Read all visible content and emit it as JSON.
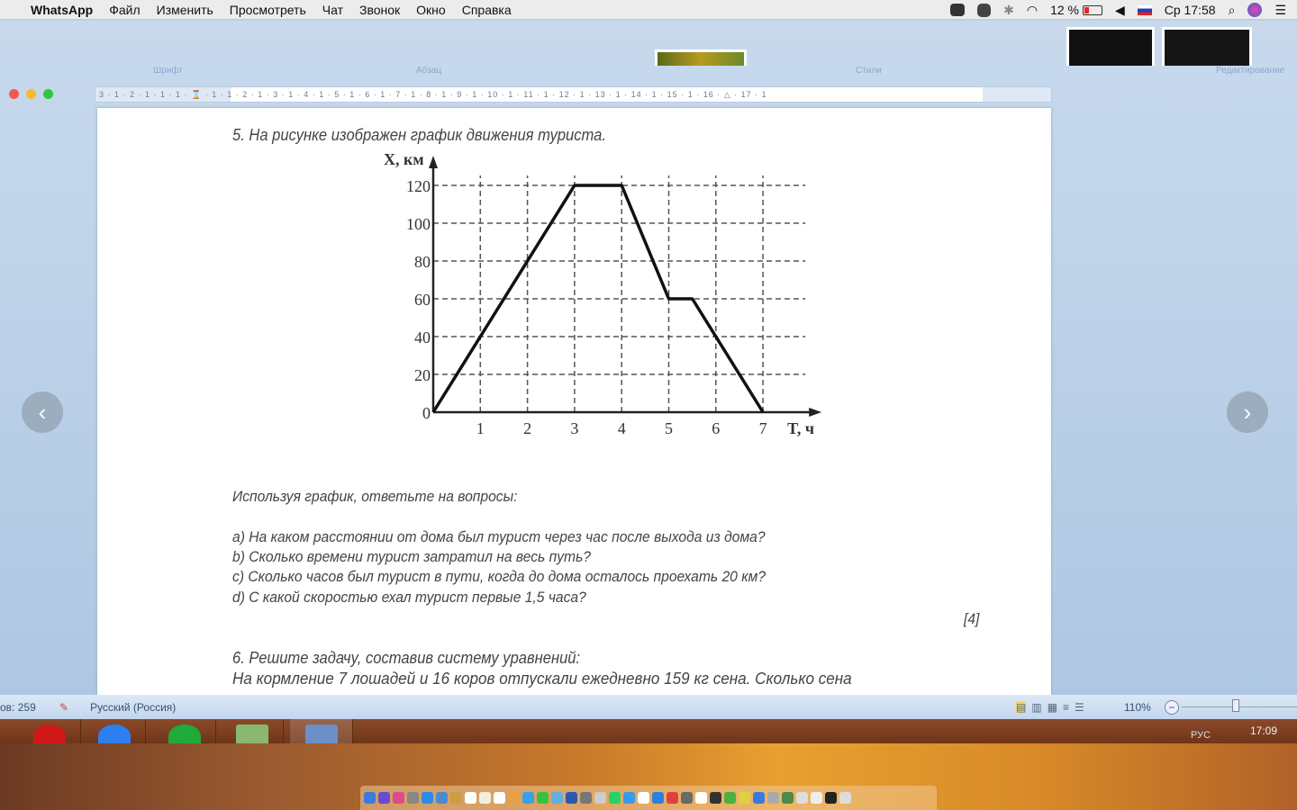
{
  "menubar": {
    "app": "WhatsApp",
    "items": [
      "Файл",
      "Изменить",
      "Просмотреть",
      "Чат",
      "Звонок",
      "Окно",
      "Справка"
    ],
    "battery": "12 %",
    "clock": "Ср 17:58"
  },
  "ribbon": {
    "groups": [
      "Шрифт",
      "Абзац",
      "Стили",
      "Редактирование"
    ]
  },
  "ruler": {
    "text": "3 · 1 · 2 · 1 · 1 · 1 · ⌛ · 1 · 1 · 2 · 1 · 3 · 1 · 4 · 1 · 5 · 1 · 6 · 1 · 7 · 1 · 8 · 1 · 9 · 1 · 10 · 1 · 11 · 1 · 12 · 1 · 13 · 1 · 14 · 1 · 15 · 1 · 16 · △ · 17 · 1"
  },
  "document": {
    "task5": "5. На рисунке изображен график движения туриста.",
    "instruction": "Используя график, ответьте на вопросы:",
    "questions": [
      "a) На каком расстоянии от дома был турист через час после выхода из дома?",
      "b) Сколько времени турист затратил на весь путь?",
      "c) Сколько часов был турист в пути, когда до дома осталось проехать 20 км?",
      "d) С какой скоростью ехал турист первые 1,5 часа?"
    ],
    "points": "[4]",
    "task6": "6. Решите задачу, составив систему уравнений:",
    "task6_text": "На кормление 7 лошадей и 16 коров отпускали ежедневно 159 кг сена. Сколько сена"
  },
  "chart_data": {
    "type": "line",
    "ylabel": "X, км",
    "xlabel": "T, ч",
    "x_ticks": [
      "1",
      "2",
      "3",
      "4",
      "5",
      "6",
      "7"
    ],
    "y_ticks": [
      "0",
      "20",
      "40",
      "60",
      "80",
      "100",
      "120"
    ],
    "grid": true,
    "xlim": [
      0,
      7.9
    ],
    "ylim": [
      0,
      130
    ],
    "series": [
      {
        "x": [
          0,
          3,
          4,
          5,
          5.5,
          7
        ],
        "y": [
          0,
          120,
          120,
          60,
          60,
          0
        ]
      }
    ]
  },
  "statusbar": {
    "words": "ов: 259",
    "language": "Русский (Россия)",
    "zoom": "110%"
  },
  "taskbar": {
    "clock": "17:09",
    "lang": "РУС"
  },
  "colors": {
    "menubar": "#ececec",
    "word_blue": "#c8d9ec",
    "taskbar": "#7a3d1f"
  }
}
